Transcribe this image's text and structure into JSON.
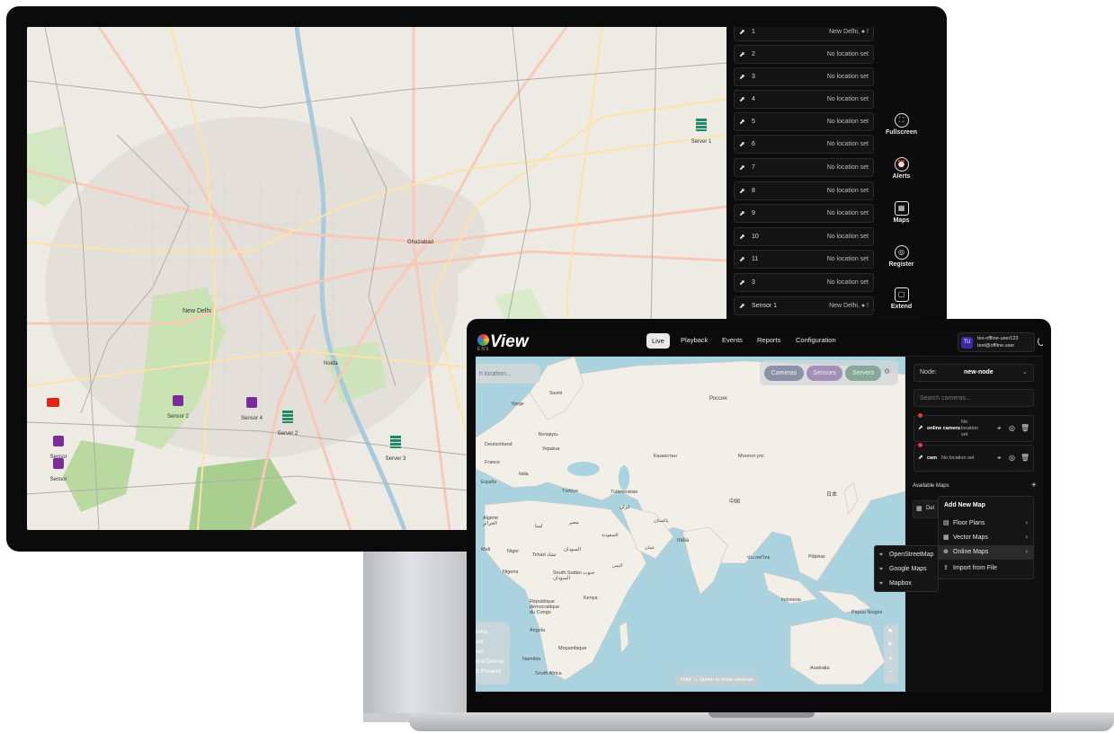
{
  "monitor": {
    "camera_list": [
      {
        "num": "1",
        "location": "New Delhi, ● !"
      },
      {
        "num": "2",
        "location": "No location set"
      },
      {
        "num": "3",
        "location": "No location set"
      },
      {
        "num": "4",
        "location": "No location set"
      },
      {
        "num": "5",
        "location": "No location set"
      },
      {
        "num": "6",
        "location": "No location set"
      },
      {
        "num": "7",
        "location": "No location set"
      },
      {
        "num": "8",
        "location": "No location set"
      },
      {
        "num": "9",
        "location": "No location set"
      },
      {
        "num": "10",
        "location": "No location set"
      },
      {
        "num": "11",
        "location": "No location set"
      },
      {
        "num": "3",
        "location": "No location set"
      },
      {
        "num": "Sensor 1",
        "location": "New Delhi, ● !"
      }
    ],
    "side_buttons": {
      "fullscreen": "Fullscreen",
      "alerts": "Alerts",
      "maps": "Maps",
      "register": "Register",
      "extend": "Extend"
    },
    "map_labels": {
      "new_delhi": "New Delhi",
      "ghaziabad": "Ghaziabad",
      "noida": "Noida",
      "server1": "Server 1",
      "server2": "Server 2",
      "server3": "Server 3",
      "sensor2": "Sensor 2",
      "sensor4": "Sensor 4",
      "sensor_a": "Sensor",
      "sensor_b": "Sensor"
    }
  },
  "laptop": {
    "brand": "View",
    "brand_sub": "ENS",
    "nav": {
      "live": "Live",
      "playback": "Playback",
      "events": "Events",
      "reports": "Reports",
      "configuration": "Configuration"
    },
    "user": {
      "initials": "TU",
      "name": "tes-offline-user123",
      "email": "test@offline.user"
    },
    "map": {
      "search_placeholder": "h location...",
      "filters": {
        "cameras": "Cameras",
        "sensors": "Sensors",
        "servers": "Servers"
      },
      "legend": [
        "nera",
        "sor",
        "ver",
        "line Device",
        "rt Present"
      ],
      "hint": "Hold ⌥ Option to move cameras",
      "labels": {
        "russia": "Россия",
        "kazakhstan": "Казахстан",
        "mongolia": "Монгол улс",
        "china": "中国",
        "india": "India",
        "japan": "日本",
        "deutschland": "Deutschland",
        "france": "France",
        "ukraine": "Україна",
        "turkiye": "Türkiye",
        "iran": "ایران",
        "algerie": "Algérie\nالجزائر",
        "libya": "ليبيا",
        "egypt": "مصر",
        "mali": "Mali",
        "niger": "Niger",
        "tchad": "Tchad تشاد",
        "sudan": "السودان",
        "nigeria": "Nigeria",
        "south_sudan": "South Sudan جنوب\nالسودان",
        "drc": "République\ndémocratique\ndu Congo",
        "kenya": "Kenya",
        "angola": "Angola",
        "mocambique": "Moçambique",
        "namibia": "Namibia",
        "south_africa": "South Africa",
        "australia": "Australia",
        "papua": "Papua Niugini",
        "suomi": "Suomi",
        "norge": "Norge",
        "belarus": "Беларусь",
        "espana": "España",
        "italia": "Italia",
        "turkmenistan": "Türkmenistan",
        "pakistan": "پاکستان",
        "yemen": "اليمن",
        "oman": "عمان",
        "saudi": "السعودية",
        "thailand": "ประเทศไทย",
        "indonesia": "Indonesia",
        "philippines": "Pilipinas"
      }
    },
    "panel": {
      "node_label": "Node:",
      "node_value": "new-node",
      "search_placeholder": "Search cameras...",
      "cameras": [
        {
          "name": "online camera",
          "location": "No location set"
        },
        {
          "name": "cam",
          "location": "No location set"
        }
      ],
      "available_maps": "Available Maps",
      "map_item": "Del",
      "add_menu": {
        "title": "Add New Map",
        "items": [
          "Floor Plans",
          "Vector Maps",
          "Online Maps",
          "Import from File"
        ]
      },
      "online_submenu": [
        "OpenStreetMap",
        "Google Maps",
        "Mapbox"
      ]
    }
  },
  "colors": {
    "accent_purple": "#3b2aa8",
    "filter_cameras": "#8a93a5",
    "filter_sensors": "#a58fb8",
    "filter_servers": "#86a898",
    "ocean": "#aad3df",
    "land": "#f2efe9"
  }
}
